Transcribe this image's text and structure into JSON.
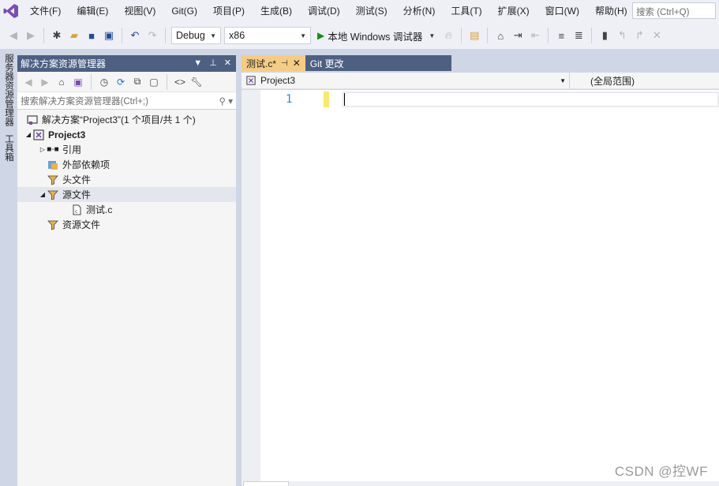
{
  "menubar": {
    "items": [
      "文件(F)",
      "编辑(E)",
      "视图(V)",
      "Git(G)",
      "项目(P)",
      "生成(B)",
      "调试(D)",
      "测试(S)",
      "分析(N)",
      "工具(T)",
      "扩展(X)",
      "窗口(W)",
      "帮助(H)"
    ],
    "search_placeholder": "搜索 (Ctrl+Q)"
  },
  "toolbar": {
    "config": "Debug",
    "platform": "x86",
    "run_label": "本地 Windows 调试器"
  },
  "left_strip": {
    "tabs": [
      "服务器资源管理器",
      "工具箱"
    ]
  },
  "solution_explorer": {
    "title": "解决方案资源管理器",
    "search_placeholder": "搜索解决方案资源管理器(Ctrl+;)",
    "tree": [
      {
        "label": "解决方案“Project3”(1 个项目/共 1 个)",
        "level": 0
      },
      {
        "label": "Project3",
        "level": 1
      },
      {
        "label": "引用",
        "level": 2
      },
      {
        "label": "外部依赖项",
        "level": 2
      },
      {
        "label": "头文件",
        "level": 2
      },
      {
        "label": "源文件",
        "level": 2
      },
      {
        "label": "测试.c",
        "level": 3
      },
      {
        "label": "资源文件",
        "level": 2
      }
    ]
  },
  "editor": {
    "tabs": [
      {
        "label": "测试.c*",
        "active": true
      },
      {
        "label": "Git 更改",
        "active": false
      }
    ],
    "nav_project": "Project3",
    "nav_scope": "(全局范围)",
    "line_number": "1"
  },
  "watermark": "CSDN @控WF",
  "colors": {
    "chrome_bg": "#eef0f6",
    "panel_title": "#4d6082",
    "active_tab": "#f5cc84",
    "line_number": "#2b91af"
  }
}
